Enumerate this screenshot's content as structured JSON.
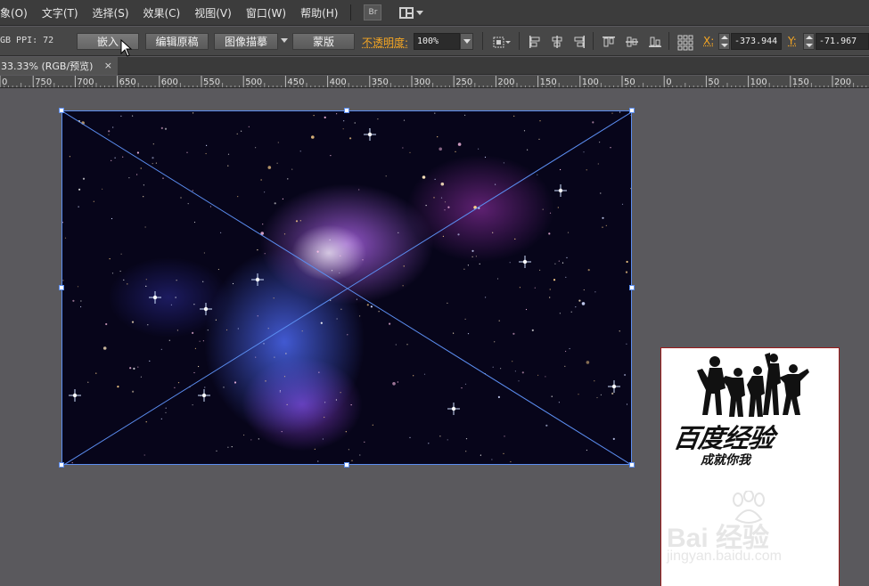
{
  "menu": {
    "items": [
      "象(O)",
      "文字(T)",
      "选择(S)",
      "效果(C)",
      "视图(V)",
      "窗口(W)",
      "帮助(H)"
    ],
    "bridge_label": "Br",
    "workspace_icon": "workspace-layout-icon"
  },
  "control_bar": {
    "info": "GB  PPI: 72",
    "embed_label": "嵌入",
    "edit_original_label": "编辑原稿",
    "image_trace_label": "图像描摹",
    "mask_label": "蒙版",
    "opacity_label": "不透明度:",
    "opacity_value": "100%",
    "x_label": "X:",
    "x_value": "-373.944",
    "y_label": "Y:",
    "y_value": "-71.967"
  },
  "document": {
    "tab_title": "33.33% (RGB/预览)",
    "close_glyph": "×"
  },
  "ruler": {
    "labels": [
      "0",
      "750",
      "700",
      "650",
      "600",
      "550",
      "500",
      "450",
      "400",
      "350",
      "300",
      "250",
      "200",
      "150",
      "100",
      "50",
      "0",
      "50",
      "100",
      "150",
      "200"
    ]
  },
  "artboard": {
    "logo_title": "百度经验",
    "logo_subtitle": "成就你我",
    "watermark_main": "Bai 经验",
    "watermark_sub": "jingyan.baidu.com"
  },
  "colors": {
    "accent_orange": "#f5a623",
    "selection_blue": "#5b8df0",
    "artboard_border": "#9b1b1b"
  }
}
